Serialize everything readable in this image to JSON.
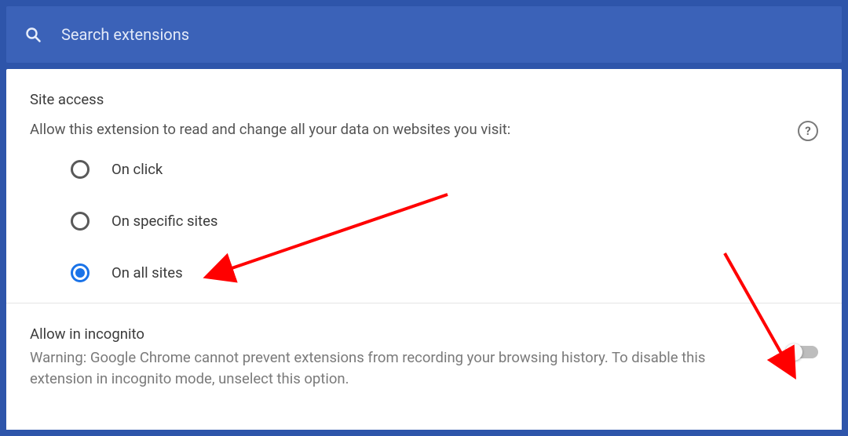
{
  "search": {
    "placeholder": "Search extensions"
  },
  "site_access": {
    "title": "Site access",
    "description": "Allow this extension to read and change all your data on websites you visit:",
    "options": [
      {
        "label": "On click",
        "checked": false
      },
      {
        "label": "On specific sites",
        "checked": false
      },
      {
        "label": "On all sites",
        "checked": true
      }
    ]
  },
  "incognito": {
    "title": "Allow in incognito",
    "warning": "Warning: Google Chrome cannot prevent extensions from recording your browsing history. To disable this extension in incognito mode, unselect this option.",
    "enabled": false
  },
  "annotations": {
    "arrow_color": "#ff0000"
  }
}
